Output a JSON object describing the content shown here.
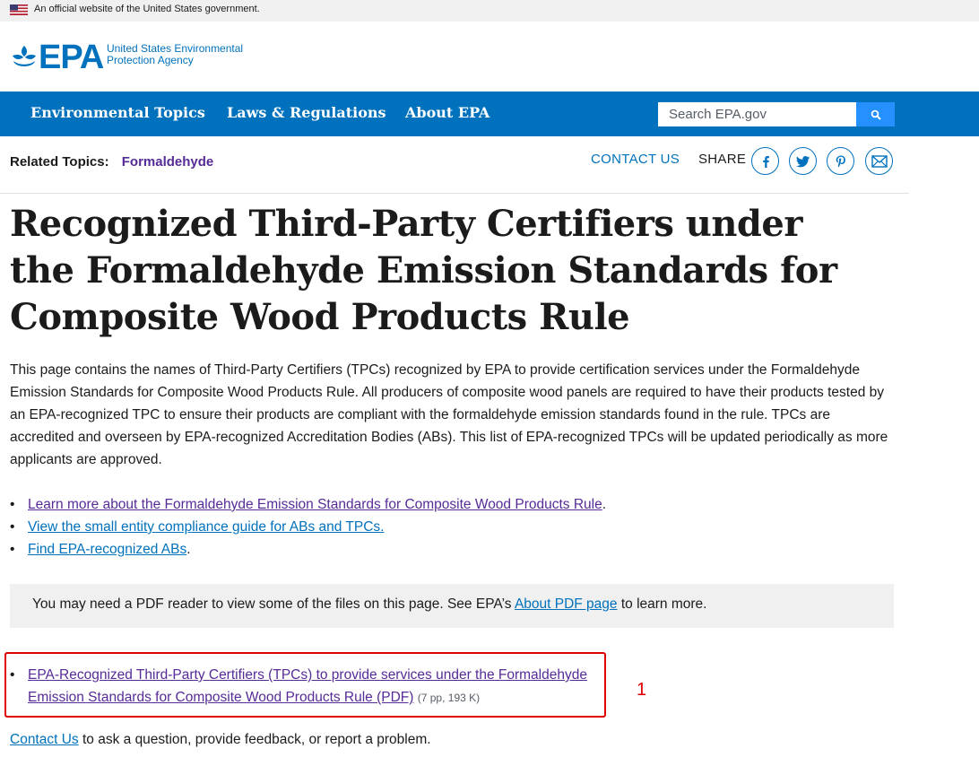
{
  "gov_banner": {
    "text": "An official website of the United States government."
  },
  "logo": {
    "word": "EPA",
    "agency_line1": "United States Environmental",
    "agency_line2": "Protection Agency"
  },
  "nav": {
    "items": [
      "Environmental Topics",
      "Laws & Regulations",
      "About EPA"
    ],
    "search_placeholder": "Search EPA.gov"
  },
  "related": {
    "label": "Related Topics:",
    "link": "Formaldehyde"
  },
  "utility": {
    "contact": "CONTACT US",
    "share": "SHARE",
    "share_icons": [
      "facebook-icon",
      "twitter-icon",
      "pinterest-icon",
      "email-icon"
    ]
  },
  "page": {
    "title": "Recognized Third-Party Certifiers under the Formaldehyde Emission Standards for Composite Wood Products Rule",
    "intro": "This page contains the names of Third-Party Certifiers (TPCs) recognized by EPA to provide certification services under the Formaldehyde Emission Standards for Composite Wood Products Rule. All producers of composite wood panels are required to have their products tested by an EPA-recognized TPC to ensure their products are compliant with the formaldehyde emission standards found in the rule. TPCs are accredited and overseen by EPA-recognized Accreditation Bodies (ABs). This list of EPA-recognized TPCs will be updated periodically as more applicants are approved.",
    "links": [
      {
        "text": "Learn more about the Formaldehyde Emission Standards for Composite Wood Products Rule",
        "suffix": "."
      },
      {
        "text": "View the small entity compliance guide for ABs and TPCs.",
        "suffix": ""
      },
      {
        "text": "Find EPA-recognized ABs",
        "suffix": "."
      }
    ],
    "pdf_note": {
      "before": "You may need a PDF reader to view some of the files on this page. See EPA’s ",
      "link": "About PDF page",
      "after": " to learn more."
    },
    "pdf_item": {
      "link": "EPA-Recognized Third-Party Certifiers (TPCs) to provide services under the Formaldehyde Emission Standards for Composite Wood Products Rule (PDF)",
      "meta": "(7 pp, 193 K)"
    },
    "annotation_marker": "1",
    "footer": {
      "link": "Contact Us",
      "text": " to ask a question, provide feedback, or report a problem."
    }
  },
  "colors": {
    "brand": "#0071bc",
    "visited": "#562b97",
    "highlight": "#e00000",
    "search_button": "#2491ff"
  }
}
